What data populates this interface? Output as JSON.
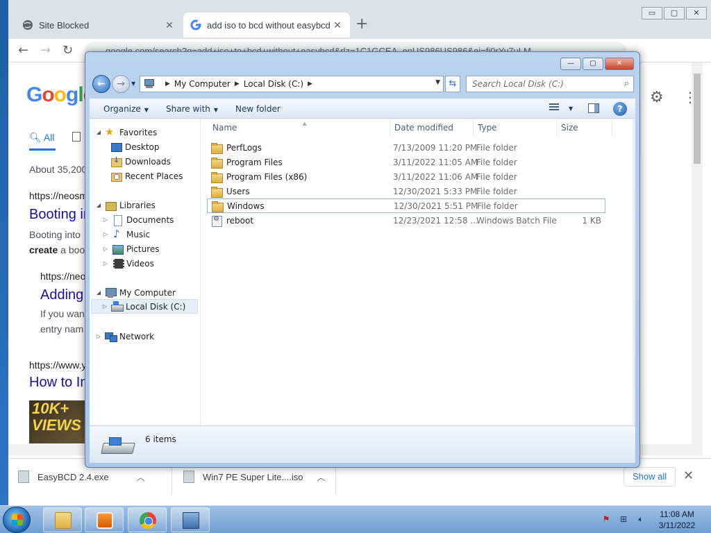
{
  "browser": {
    "tabs": [
      {
        "title": "Site Blocked",
        "close": "✕"
      },
      {
        "title": "add iso to bcd without easybcd -",
        "close": "✕"
      }
    ],
    "new_tab": "+",
    "window_buttons": {
      "minimize": "▭",
      "maximize": "▢",
      "close": "✕"
    },
    "nav": {
      "back": "←",
      "forward": "→",
      "reload": "↻"
    },
    "url": "google.com/search?q=add+iso+to+bcd+without+easybcd&rlz=1C1GCEA_enUS986US986&ei=fi0rYv7uLM",
    "page": {
      "logo": [
        "G",
        "o",
        "o",
        "g",
        "l",
        "e"
      ],
      "nav_all": "All",
      "result_count": "About 35,200",
      "results": [
        {
          "url": "https://neosm",
          "title": "Booting in",
          "snippet": "Booting into",
          "snippet_bold": "create",
          "snippet_tail": " a boo"
        },
        {
          "url": "https://neo",
          "title": "Adding",
          "snippet": "If you wan",
          "snippet2": "entry nam"
        },
        {
          "url": "https://www.y",
          "title": "How to In"
        }
      ],
      "thumb_text": "10K+ VIEWS"
    },
    "downloads": [
      {
        "name": "EasyBCD 2.4.exe"
      },
      {
        "name": "Win7 PE Super Lite....iso"
      }
    ],
    "show_all": "Show all",
    "close_downloads": "✕"
  },
  "explorer": {
    "caption": {
      "minimize": "—",
      "maximize": "▢",
      "close": "✕"
    },
    "address": {
      "crumbs": [
        "My Computer",
        "Local Disk (C:)"
      ]
    },
    "search_placeholder": "Search Local Disk (C:)",
    "commands": {
      "organize": "Organize",
      "share_with": "Share with",
      "new_folder": "New folder"
    },
    "help": "?",
    "nav_tree": {
      "favorites": {
        "label": "Favorites",
        "items": [
          "Desktop",
          "Downloads",
          "Recent Places"
        ]
      },
      "libraries": {
        "label": "Libraries",
        "items": [
          "Documents",
          "Music",
          "Pictures",
          "Videos"
        ]
      },
      "computer": {
        "label": "My Computer",
        "items": [
          "Local Disk (C:)"
        ]
      },
      "network": {
        "label": "Network"
      }
    },
    "columns": {
      "name": "Name",
      "date": "Date modified",
      "type": "Type",
      "size": "Size"
    },
    "files": [
      {
        "name": "PerfLogs",
        "date": "7/13/2009 11:20 PM",
        "type": "File folder",
        "size": "",
        "icon": "folder-icon"
      },
      {
        "name": "Program Files",
        "date": "3/11/2022 11:05 AM",
        "type": "File folder",
        "size": "",
        "icon": "folder-icon"
      },
      {
        "name": "Program Files (x86)",
        "date": "3/11/2022 11:06 AM",
        "type": "File folder",
        "size": "",
        "icon": "folder-icon"
      },
      {
        "name": "Users",
        "date": "12/30/2021 5:33 PM",
        "type": "File folder",
        "size": "",
        "icon": "folder-icon"
      },
      {
        "name": "Windows",
        "date": "12/30/2021 5:51 PM",
        "type": "File folder",
        "size": "",
        "icon": "folder-icon",
        "selected": true
      },
      {
        "name": "reboot",
        "date": "12/23/2021 12:58 ...",
        "type": "Windows Batch File",
        "size": "1 KB",
        "icon": "batch-file-icon"
      }
    ],
    "status": {
      "item_count": "6 items"
    }
  },
  "taskbar": {
    "clock": {
      "time": "11:08 AM",
      "date": "3/11/2022"
    },
    "apps": [
      "windows-explorer-icon",
      "media-player-icon",
      "chrome-icon",
      "computer-icon"
    ]
  },
  "colors": {
    "accent": "#1a73e8",
    "link": "#1a0dab",
    "explorer_frame": "#bcd3ee",
    "close_red": "#c6462f"
  }
}
